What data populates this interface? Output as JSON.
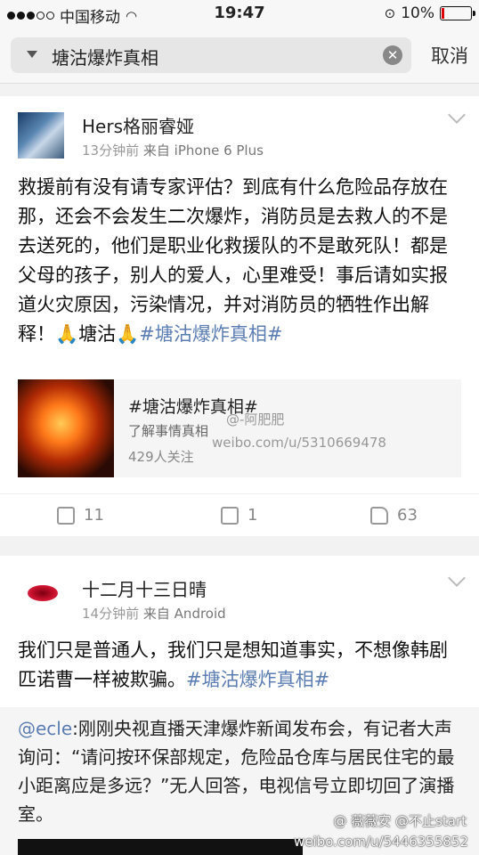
{
  "status_bar": {
    "carrier": "中国移动",
    "time": "19:47",
    "battery": "10%",
    "battery_level": 0.1
  },
  "search": {
    "query": "塘沽爆炸真相",
    "cancel_label": "取消"
  },
  "posts": [
    {
      "username": "Hers格丽睿娅",
      "time": "13分钟前",
      "source_prefix": "来自",
      "source": "iPhone 6 Plus",
      "text": "救援前有没有请专家评估？到底有什么危险品存放在那，还会不会发生二次爆炸，消防员是去救人的不是去送死的，他们是职业化救援队的不是敢死队！都是父母的孩子，别人的爱人，心里难受！事后请如实报道火灾原因，污染情况，并对消防员的牺牲作出解释！🙏塘沽🙏",
      "hashtag": "#塘沽爆炸真相#",
      "topic": {
        "title": "#塘沽爆炸真相#",
        "desc": "了解事情真相",
        "followers": "429人关注"
      },
      "actions": {
        "repost": "11",
        "comment": "1",
        "like": "63"
      }
    },
    {
      "username": "十二月十三日晴",
      "time": "14分钟前",
      "source_prefix": "来自",
      "source": "Android",
      "text": "我们只是普通人，我们只是想知道事实，不想像韩剧匹诺曹一样被欺骗。",
      "hashtag": "#塘沽爆炸真相#",
      "quote": {
        "mention": "@ecle",
        "text": ":刚刚央视直播天津爆炸新闻发布会，有记者大声询问：“请问按环保部规定，危险品仓库与居民住宅的最小距离应是多远？”无人回答，电视信号立即切回了演播室。"
      }
    }
  ],
  "watermarks": {
    "wm1_name": "@-阿肥肥",
    "wm1_url": "weibo.com/u/5310669478",
    "wm2_name": "@ 薇薇安 @不止start",
    "wm2_url": "weibo.com/u/5446355852"
  }
}
